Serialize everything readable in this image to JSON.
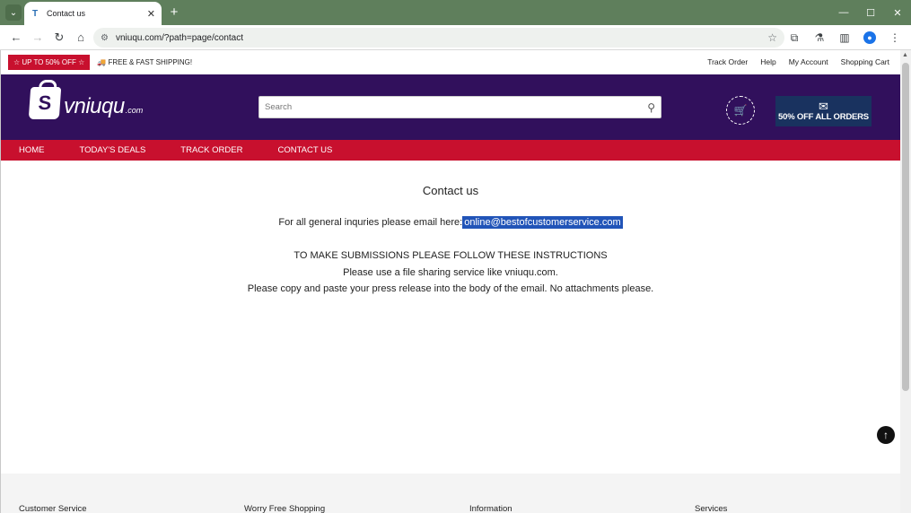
{
  "browser": {
    "tab_title": "Contact us",
    "new_tab": "+",
    "url": "vniuqu.com/?path=page/contact"
  },
  "topbar": {
    "promo": "☆ UP TO 50% OFF ☆",
    "shipping": "🚚 FREE & FAST SHIPPING!",
    "links": [
      "Track Order",
      "Help",
      "My Account",
      "Shopping Cart"
    ]
  },
  "header": {
    "logo_text": "vniuqu",
    "logo_suffix": ".com",
    "search_placeholder": "Search",
    "deal_text": "50% OFF ALL ORDERS"
  },
  "nav": [
    "HOME",
    "TODAY'S DEALS",
    "TRACK ORDER",
    "CONTACT US"
  ],
  "main": {
    "title": "Contact us",
    "inquiry_text": "For all general inquries please email here:",
    "email": "online@bestofcustomerservice.com",
    "instructions_heading": "TO MAKE SUBMISSIONS PLEASE FOLLOW THESE INSTRUCTIONS",
    "instruction_1": "Please use a file sharing service like vniuqu.com.",
    "instruction_2": "Please copy and paste your press release into the body of the email. No attachments please."
  },
  "footer": {
    "headings": [
      "Customer Service",
      "Worry Free Shopping",
      "Information",
      "Services"
    ]
  },
  "colors": {
    "header_bg": "#31105c",
    "nav_bg": "#c8102e",
    "selection": "#2154b8"
  }
}
